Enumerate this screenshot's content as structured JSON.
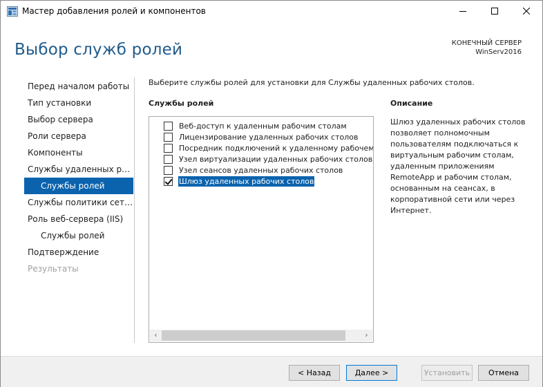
{
  "window": {
    "title": "Мастер добавления ролей и компонентов"
  },
  "header": {
    "page_title": "Выбор служб ролей",
    "destination_label": "КОНЕЧНЫЙ СЕРВЕР",
    "destination_value": "WinServ2016"
  },
  "nav": {
    "items": [
      {
        "label": "Перед началом работы",
        "state": "normal",
        "sub": false
      },
      {
        "label": "Тип установки",
        "state": "normal",
        "sub": false
      },
      {
        "label": "Выбор сервера",
        "state": "normal",
        "sub": false
      },
      {
        "label": "Роли сервера",
        "state": "normal",
        "sub": false
      },
      {
        "label": "Компоненты",
        "state": "normal",
        "sub": false
      },
      {
        "label": "Службы удаленных рабо...",
        "state": "normal",
        "sub": false
      },
      {
        "label": "Службы ролей",
        "state": "active",
        "sub": true
      },
      {
        "label": "Службы политики сети и...",
        "state": "normal",
        "sub": false
      },
      {
        "label": "Роль веб-сервера (IIS)",
        "state": "normal",
        "sub": false
      },
      {
        "label": "Службы ролей",
        "state": "normal",
        "sub": true
      },
      {
        "label": "Подтверждение",
        "state": "normal",
        "sub": false
      },
      {
        "label": "Результаты",
        "state": "disabled",
        "sub": false
      }
    ]
  },
  "main": {
    "instruction": "Выберите службы ролей для установки для Службы удаленных рабочих столов.",
    "roles_header": "Службы ролей",
    "description_header": "Описание",
    "roles": [
      {
        "label": "Веб-доступ к удаленным рабочим столам",
        "checked": false,
        "selected": false
      },
      {
        "label": "Лицензирование удаленных рабочих столов",
        "checked": false,
        "selected": false
      },
      {
        "label": "Посредник подключений к удаленному рабочему с",
        "checked": false,
        "selected": false
      },
      {
        "label": "Узел виртуализации удаленных рабочих столов",
        "checked": false,
        "selected": false
      },
      {
        "label": "Узел сеансов удаленных рабочих столов",
        "checked": false,
        "selected": false
      },
      {
        "label": "Шлюз удаленных рабочих столов",
        "checked": true,
        "selected": true
      }
    ],
    "description": "Шлюз удаленных рабочих столов позволяет полномочным пользователям подключаться к виртуальным рабочим столам, удаленным приложениям RemoteApp и рабочим столам, основанным на сеансах, в корпоративной сети или через Интернет."
  },
  "footer": {
    "prev_label": "< Назад",
    "next_label": "Далее >",
    "install_label": "Установить",
    "cancel_label": "Отмена"
  },
  "colors": {
    "accent": "#0b63ae",
    "title_blue": "#1f5b8c",
    "footer_bg": "#f0f0f0"
  }
}
